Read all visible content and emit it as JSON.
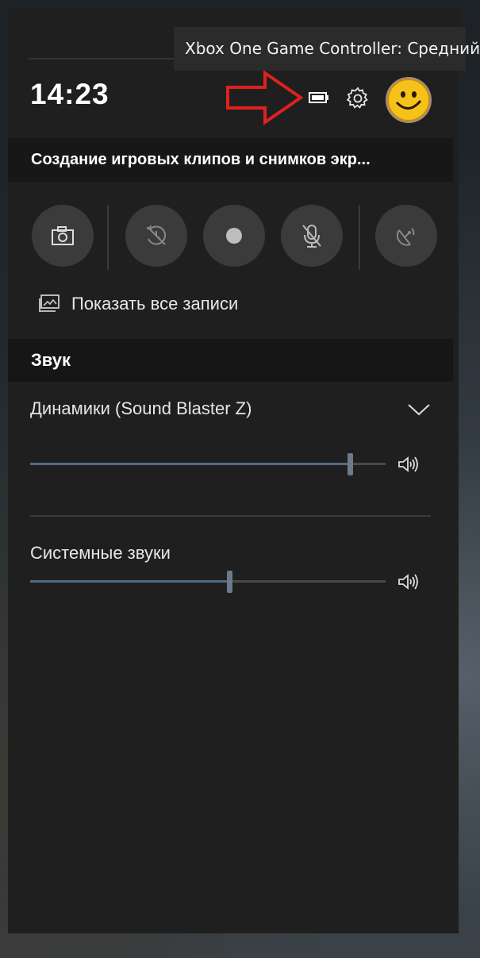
{
  "header": {
    "time": "14:23",
    "tooltip": "Xbox One Game Controller: Средний"
  },
  "capture_widget": {
    "title": "Создание игровых клипов и снимков экр...",
    "buttons": [
      {
        "name": "screenshot",
        "icon": "camera-icon"
      },
      {
        "name": "record-last",
        "icon": "record-last-icon"
      },
      {
        "name": "record",
        "icon": "record-dot-icon"
      },
      {
        "name": "mic",
        "icon": "mic-off-icon"
      },
      {
        "name": "broadcast",
        "icon": "broadcast-icon"
      }
    ],
    "show_all_label": "Показать все записи"
  },
  "sound": {
    "title": "Звук",
    "device_label": "Динамики (Sound Blaster Z)",
    "device_volume": 0.9,
    "system_label": "Системные звуки",
    "system_volume": 0.56
  },
  "colors": {
    "panel": "#1f1f1f",
    "accent_arrow": "#e02020",
    "slider_fill": "#546a80"
  }
}
